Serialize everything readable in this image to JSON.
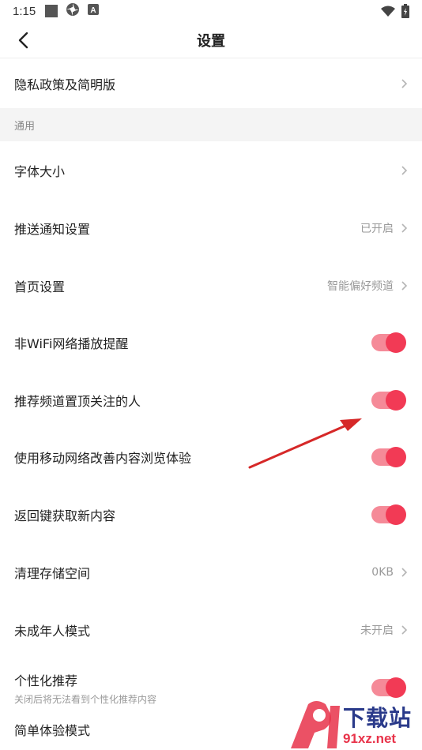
{
  "status_bar": {
    "time": "1:15",
    "icons": [
      "square-icon",
      "pinwheel-icon",
      "a-badge-icon",
      "wifi-icon",
      "battery-icon"
    ]
  },
  "header": {
    "title": "设置",
    "back_icon": "chevron-left-icon"
  },
  "rows_top": [
    {
      "label": "隐私政策及简明版",
      "value": ""
    }
  ],
  "section": {
    "title": "通用"
  },
  "rows": [
    {
      "label": "字体大小",
      "value": ""
    },
    {
      "label": "推送通知设置",
      "value": "已开启"
    },
    {
      "label": "首页设置",
      "value": "智能偏好频道"
    },
    {
      "label": "非WiFi网络播放提醒",
      "toggle": true
    },
    {
      "label": "推荐频道置顶关注的人",
      "toggle": true
    },
    {
      "label": "使用移动网络改善内容浏览体验",
      "toggle": true
    },
    {
      "label": "返回键获取新内容",
      "toggle": true
    },
    {
      "label": "清理存储空间",
      "value": "0KB"
    },
    {
      "label": "未成年人模式",
      "value": "未开启"
    }
  ],
  "personalized": {
    "label": "个性化推荐",
    "sub": "关闭后将无法看到个性化推荐内容",
    "toggle": true
  },
  "simple_mode": {
    "label": "简单体验模式"
  },
  "colors": {
    "accent": "#f23a55",
    "toggle_track": "#f58a98",
    "arrow": "#d62828"
  },
  "watermark": {
    "cn": "下载站",
    "en": "91xz.net"
  }
}
